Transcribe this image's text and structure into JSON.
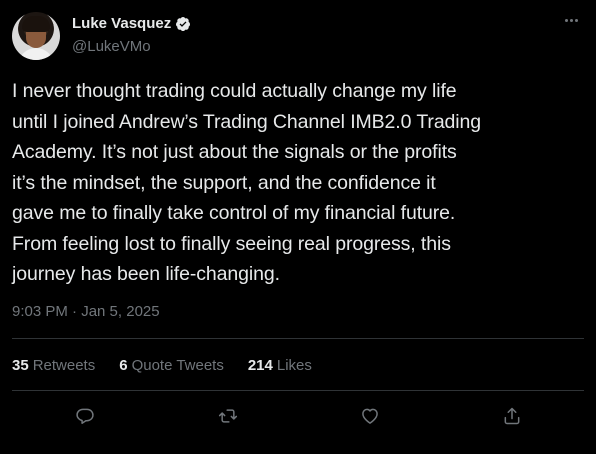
{
  "author": {
    "display_name": "Luke Vasquez",
    "handle": "@LukeVMo",
    "verified_icon": "verified-badge-icon"
  },
  "tweet": {
    "text": "I never thought trading could actually change my life\nuntil I joined Andrew’s Trading Channel IMB2.0 Trading\nAcademy. It’s not just about the signals or the profits\nit’s the mindset, the support, and the confidence it\ngave me to finally take control of my financial future.\nFrom feeling lost to finally seeing real progress, this\njourney has been life-changing.",
    "timestamp": "9:03 PM · Jan 5, 2025"
  },
  "stats": {
    "retweets_count": "35",
    "retweets_label": "Retweets",
    "quote_tweets_count": "6",
    "quote_tweets_label": "Quote Tweets",
    "likes_count": "214",
    "likes_label": "Likes"
  },
  "actions": {
    "reply_icon": "reply-icon",
    "retweet_icon": "retweet-icon",
    "like_icon": "heart-icon",
    "share_icon": "share-icon",
    "more_icon": "more-icon"
  },
  "colors": {
    "background": "#000000",
    "primary_text": "#e7e9ea",
    "secondary_text": "#71767b",
    "divider": "#2f3336"
  }
}
